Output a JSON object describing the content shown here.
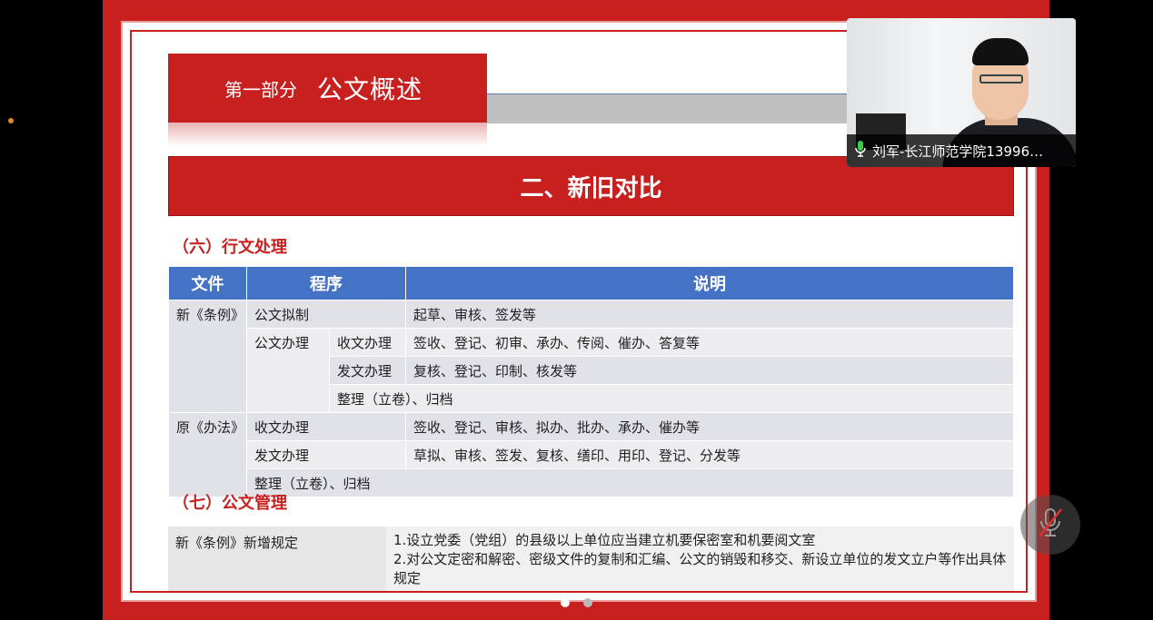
{
  "slide": {
    "part_label": "第一部分",
    "part_title": "公文概述",
    "section_title": "二、新旧对比",
    "subsection_6": "（六）行文处理",
    "subsection_7": "（七）公文管理",
    "table": {
      "headers": [
        "文件",
        "程序",
        "说明"
      ],
      "rows": [
        {
          "file": "新《条例》",
          "proc1": "公文拟制",
          "proc2": "",
          "desc": "起草、审核、签发等"
        },
        {
          "file": "",
          "proc1": "公文办理",
          "proc2": "收文办理",
          "desc": "签收、登记、初审、承办、传阅、催办、答复等"
        },
        {
          "file": "",
          "proc1": "",
          "proc2": "发文办理",
          "desc": "复核、登记、印制、核发等"
        },
        {
          "file": "",
          "proc1": "",
          "proc2": "整理（立卷）、归档",
          "desc": ""
        },
        {
          "file": "原《办法》",
          "proc1": "收文办理",
          "proc2": "",
          "desc": "签收、登记、审核、拟办、批办、承办、催办等"
        },
        {
          "file": "",
          "proc1": "发文办理",
          "proc2": "",
          "desc": "草拟、审核、签发、复核、缮印、用印、登记、分发等"
        },
        {
          "file": "",
          "proc1": "整理（立卷）、归档",
          "proc2": "",
          "desc": ""
        }
      ]
    },
    "management": {
      "label": "新《条例》新增规定",
      "line1": "1.设立党委（党组）的县级以上单位应当建立机要保密室和机要阅文室",
      "line2": "2.对公文定密和解密、密级文件的复制和汇编、公文的销毁和移交、新设立单位的发文立户等作出具体规定"
    }
  },
  "video": {
    "participant_name": "刘军-长江师范学院13996…",
    "mic_icon": "microphone-icon",
    "mute_icon": "microphone-muted-icon"
  },
  "pager": {
    "pages": 2,
    "current": 1
  },
  "colors": {
    "slide_red": "#c8201f",
    "table_header_blue": "#4472c4"
  }
}
